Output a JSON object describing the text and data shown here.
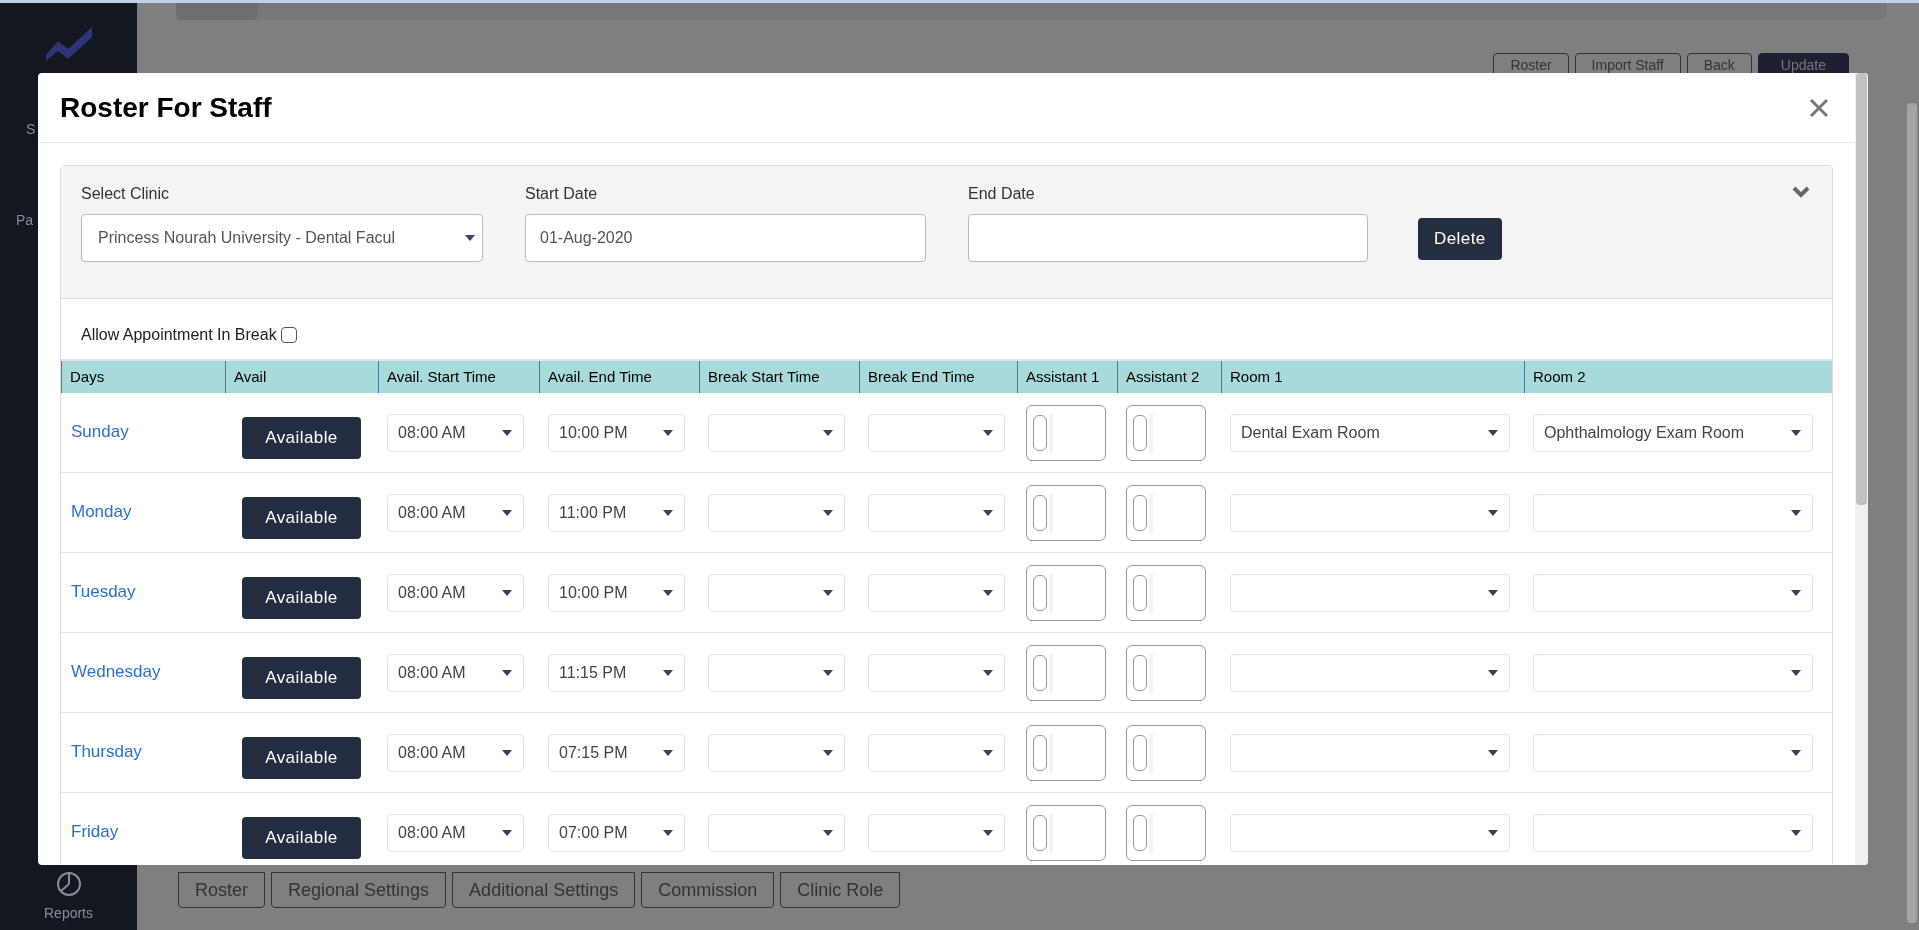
{
  "sidebar": {
    "items": [
      {
        "label": "S"
      },
      {
        "label": "Pa"
      }
    ],
    "bottom_item": {
      "label": "Reports"
    }
  },
  "page": {
    "actions": [
      {
        "label": "Roster",
        "kind": "outline"
      },
      {
        "label": "Import Staff",
        "kind": "outline"
      },
      {
        "label": "Back",
        "kind": "outline"
      },
      {
        "label": "Update",
        "kind": "primary"
      }
    ],
    "tabs": [
      "Roster",
      "Regional Settings",
      "Additional Settings",
      "Commission",
      "Clinic Role"
    ]
  },
  "modal": {
    "title": "Roster For Staff",
    "filters": {
      "clinic": {
        "label": "Select Clinic",
        "value": "Princess Nourah University - Dental Facul"
      },
      "start_date": {
        "label": "Start Date",
        "value": "01-Aug-2020"
      },
      "end_date": {
        "label": "End Date"
      },
      "delete_button": "Delete"
    },
    "allow_break": {
      "label": "Allow Appointment In Break",
      "checked": false
    },
    "table": {
      "columns": [
        "Days",
        "Avail",
        "Avail. Start Time",
        "Avail. End Time",
        "Break Start Time",
        "Break End Time",
        "Assistant 1",
        "Assistant 2",
        "Room 1",
        "Room 2"
      ],
      "rows": [
        {
          "day": "Sunday",
          "avail": "Available",
          "start": "08:00 AM",
          "end": "10:00 PM",
          "room_1": "Dental Exam Room",
          "room_2": "Ophthalmology Exam Room"
        },
        {
          "day": "Monday",
          "avail": "Available",
          "start": "08:00 AM",
          "end": "11:00 PM"
        },
        {
          "day": "Tuesday",
          "avail": "Available",
          "start": "08:00 AM",
          "end": "10:00 PM"
        },
        {
          "day": "Wednesday",
          "avail": "Available",
          "start": "08:00 AM",
          "end": "11:15 PM"
        },
        {
          "day": "Thursday",
          "avail": "Available",
          "start": "08:00 AM",
          "end": "07:15 PM"
        },
        {
          "day": "Friday",
          "avail": "Available",
          "start": "08:00 AM",
          "end": "07:00 PM"
        }
      ]
    }
  }
}
